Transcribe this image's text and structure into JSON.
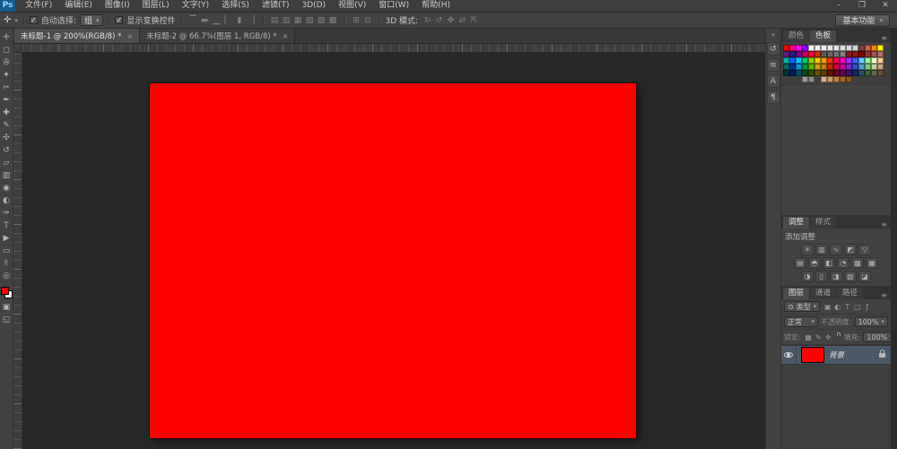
{
  "window": {
    "controls": [
      {
        "name": "minimize",
        "glyph": "–"
      },
      {
        "name": "restore",
        "glyph": "❐"
      },
      {
        "name": "close",
        "glyph": "✕"
      }
    ]
  },
  "menubar": {
    "logo": "Ps",
    "items": [
      {
        "name": "file",
        "label": "文件(F)"
      },
      {
        "name": "edit",
        "label": "编辑(E)"
      },
      {
        "name": "image",
        "label": "图像(I)"
      },
      {
        "name": "layer",
        "label": "图层(L)"
      },
      {
        "name": "type",
        "label": "文字(Y)"
      },
      {
        "name": "select",
        "label": "选择(S)"
      },
      {
        "name": "filter",
        "label": "滤镜(T)"
      },
      {
        "name": "3d",
        "label": "3D(D)"
      },
      {
        "name": "view",
        "label": "视图(V)"
      },
      {
        "name": "window",
        "label": "窗口(W)"
      },
      {
        "name": "help",
        "label": "帮助(H)"
      }
    ]
  },
  "options": {
    "tool_icon": "✛",
    "tool_caret": "▾",
    "checkbox_glyph": "✓",
    "auto_select_label": "自动选择:",
    "auto_select_value": "组",
    "dropdown_caret": "▾",
    "show_transform_label": "显示变换控件",
    "align_icons": [
      {
        "name": "align-top-edges",
        "glyph": "▔"
      },
      {
        "name": "align-vertical-centers",
        "glyph": "▬"
      },
      {
        "name": "align-bottom-edges",
        "glyph": "▁"
      },
      {
        "name": "align-left-edges",
        "glyph": "▏"
      },
      {
        "name": "align-horizontal-centers",
        "glyph": "▮"
      },
      {
        "name": "align-right-edges",
        "glyph": "▕"
      }
    ],
    "distribute_icons": [
      {
        "name": "distribute-top-edges",
        "glyph": "▤"
      },
      {
        "name": "distribute-vertical-centers",
        "glyph": "▥"
      },
      {
        "name": "distribute-bottom-edges",
        "glyph": "▦"
      },
      {
        "name": "distribute-left-edges",
        "glyph": "▧"
      },
      {
        "name": "distribute-horizontal-centers",
        "glyph": "▨"
      },
      {
        "name": "distribute-right-edges",
        "glyph": "▩"
      }
    ],
    "extra_icons": [
      {
        "name": "auto-align-layers",
        "glyph": "⊞"
      },
      {
        "name": "3d-axis",
        "glyph": "⊟"
      }
    ],
    "threed_label": "3D 模式:",
    "threed_icons": [
      {
        "name": "3d-rotate",
        "glyph": "↻"
      },
      {
        "name": "3d-roll",
        "glyph": "↺"
      },
      {
        "name": "3d-drag",
        "glyph": "✥"
      },
      {
        "name": "3d-slide",
        "glyph": "⇄"
      },
      {
        "name": "3d-scale",
        "glyph": "⇱"
      }
    ],
    "workspace": "基本功能",
    "workspace_caret": "▾"
  },
  "tabs": [
    {
      "title": "未标题-1 @ 200%(RGB/8) *",
      "close": "×",
      "active": true
    },
    {
      "title": "未标题-2 @ 66.7%(图层 1, RGB/8) *",
      "close": "×",
      "active": false
    }
  ],
  "toolbar": {
    "tools": [
      {
        "name": "move-tool",
        "glyph": "✛"
      },
      {
        "name": "rectangular-marquee-tool",
        "glyph": "◻"
      },
      {
        "name": "lasso-tool",
        "glyph": "✇"
      },
      {
        "name": "quick-selection-tool",
        "glyph": "✦"
      },
      {
        "name": "crop-tool",
        "glyph": "✂"
      },
      {
        "name": "eyedropper-tool",
        "glyph": "✒"
      },
      {
        "name": "spot-healing-brush-tool",
        "glyph": "✚"
      },
      {
        "name": "brush-tool",
        "glyph": "✎"
      },
      {
        "name": "clone-stamp-tool",
        "glyph": "✣"
      },
      {
        "name": "history-brush-tool",
        "glyph": "↺"
      },
      {
        "name": "eraser-tool",
        "glyph": "▱"
      },
      {
        "name": "gradient-tool",
        "glyph": "▥"
      },
      {
        "name": "blur-tool",
        "glyph": "◉"
      },
      {
        "name": "dodge-tool",
        "glyph": "◐"
      },
      {
        "name": "pen-tool",
        "glyph": "✑"
      },
      {
        "name": "type-tool",
        "glyph": "T"
      },
      {
        "name": "path-selection-tool",
        "glyph": "▶"
      },
      {
        "name": "rectangle-tool",
        "glyph": "▭"
      },
      {
        "name": "hand-tool",
        "glyph": "✌"
      },
      {
        "name": "zoom-tool",
        "glyph": "◎"
      }
    ],
    "foreground_color": "#ff0000",
    "background_color": "#ffffff",
    "extra_buttons": [
      {
        "name": "edit-in-quick-mask-button",
        "glyph": "▣"
      },
      {
        "name": "screen-mode-button",
        "glyph": "◱"
      }
    ]
  },
  "canvas": {
    "fill": "#ff0000"
  },
  "dock": {
    "collapse_glyph": "«",
    "icons": [
      {
        "name": "history-panel",
        "glyph": "↺"
      },
      {
        "name": "properties-panel",
        "glyph": "≡"
      },
      {
        "name": "character-panel",
        "glyph": "A"
      },
      {
        "name": "paragraph-panel",
        "glyph": "¶"
      }
    ]
  },
  "swatches_panel": {
    "tabs": [
      "颜色",
      "色板"
    ],
    "active_tab": "色板",
    "menu_glyph": "≡",
    "rows": [
      [
        "#ff0000",
        "#ff0090",
        "#ff00ff",
        "#9900ff",
        "#f7f7f7",
        "#f2f2f2",
        "#ededed",
        "#e8e8e8",
        "#e3e3e3",
        "#dedede",
        "#d9d9d9",
        "#d4d4d4",
        "#804040",
        "#cc6633",
        "#ff8000",
        "#ffff00"
      ],
      [
        "#5f1f7f",
        "#1f1f7f",
        "#7f007f",
        "#cc0066",
        "#ff0033",
        "#cc3300",
        "#5a5a5a",
        "#666666",
        "#737373",
        "#808080",
        "#8c1a1a",
        "#991111",
        "#800000",
        "#993333",
        "#a65252",
        "#b37373"
      ],
      [
        "#00b3b3",
        "#0066ff",
        "#00ccff",
        "#00cc66",
        "#99cc00",
        "#ffcc00",
        "#ff9900",
        "#ff3300",
        "#ff0066",
        "#ff00cc",
        "#9933ff",
        "#3366ff",
        "#66ccff",
        "#99ff99",
        "#ffffcc",
        "#ffcc99"
      ],
      [
        "#006666",
        "#003399",
        "#0099cc",
        "#009933",
        "#66b300",
        "#cca300",
        "#cc7a00",
        "#cc2900",
        "#cc0052",
        "#cc00a3",
        "#7a29cc",
        "#2952cc",
        "#52a3cc",
        "#7acc7a",
        "#cccca3",
        "#cca37a"
      ],
      [
        "#003333",
        "#001a66",
        "#004d66",
        "#004d1a",
        "#334d00",
        "#665200",
        "#663d00",
        "#661400",
        "#660029",
        "#660052",
        "#3d1466",
        "#142966",
        "#295266",
        "#3d663d",
        "#666652",
        "#66523d"
      ],
      [
        null,
        null,
        null,
        "#999999",
        "#8c8c8c",
        null,
        "#d9b38c",
        "#cc9966",
        "#bf8040",
        "#a66929",
        "#8c5a1f",
        null,
        null,
        null,
        null,
        null
      ]
    ]
  },
  "adjustments_panel": {
    "tabs": [
      "调整",
      "样式"
    ],
    "active_tab": "调整",
    "menu_glyph": "≡",
    "title": "添加调整",
    "rows": [
      [
        {
          "name": "brightness-contrast",
          "glyph": "✳"
        },
        {
          "name": "levels",
          "glyph": "▥"
        },
        {
          "name": "curves",
          "glyph": "∿"
        },
        {
          "name": "exposure",
          "glyph": "◩"
        },
        {
          "name": "vibrance",
          "glyph": "▽"
        }
      ],
      [
        {
          "name": "hue-saturation",
          "glyph": "▤"
        },
        {
          "name": "color-balance",
          "glyph": "◓"
        },
        {
          "name": "black-white",
          "glyph": "◧"
        },
        {
          "name": "photo-filter",
          "glyph": "◔"
        },
        {
          "name": "channel-mixer",
          "glyph": "▩"
        },
        {
          "name": "color-lookup",
          "glyph": "▦"
        }
      ],
      [
        {
          "name": "invert",
          "glyph": "◑"
        },
        {
          "name": "posterize",
          "glyph": "▯"
        },
        {
          "name": "threshold",
          "glyph": "◨"
        },
        {
          "name": "gradient-map",
          "glyph": "▧"
        },
        {
          "name": "selective-color",
          "glyph": "◪"
        }
      ]
    ]
  },
  "layers_panel": {
    "tabs": [
      "图层",
      "通道",
      "路径"
    ],
    "active_tab": "图层",
    "menu_glyph": "≡",
    "filter_search_glyph": "⊙",
    "filter_label": "类型",
    "filter_caret": "▾",
    "filter_icons": [
      {
        "name": "pixel-layer-filter",
        "glyph": "▣"
      },
      {
        "name": "adjustment-layer-filter",
        "glyph": "◐"
      },
      {
        "name": "type-layer-filter",
        "glyph": "T"
      },
      {
        "name": "shape-layer-filter",
        "glyph": "▢"
      },
      {
        "name": "smart-object-filter",
        "glyph": "ƒ"
      }
    ],
    "blend_mode": "正常",
    "blend_caret": "▾",
    "opacity_label": "不透明度:",
    "opacity_value": "100%",
    "lock_label": "锁定:",
    "lock_icons": [
      {
        "name": "lock-transparent-pixels",
        "glyph": "▦"
      },
      {
        "name": "lock-image-pixels",
        "glyph": "✎"
      },
      {
        "name": "lock-position",
        "glyph": "✛"
      }
    ],
    "fill_label": "填充:",
    "fill_value": "100%",
    "layer": {
      "name": "背景",
      "thumb_color": "#ff0000",
      "visible": true,
      "locked": true
    }
  }
}
